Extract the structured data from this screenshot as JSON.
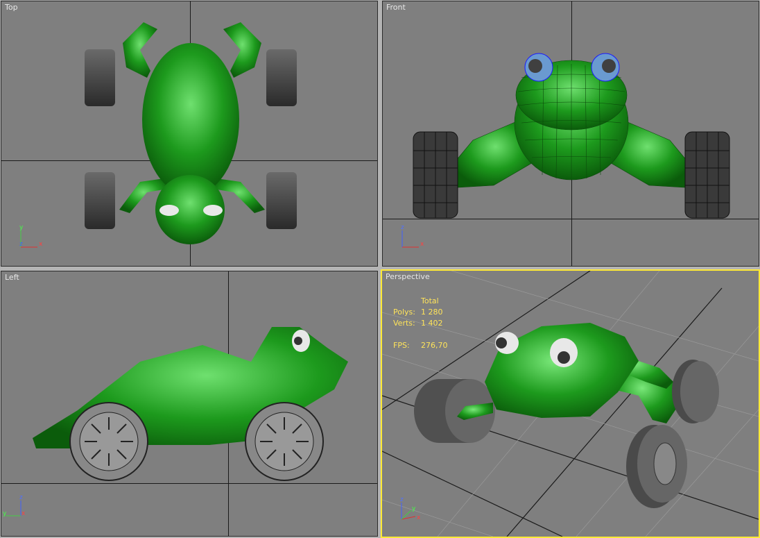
{
  "viewports": {
    "top": {
      "label": "Top",
      "axis_h": "x",
      "axis_v": "y",
      "axis_o": "z"
    },
    "front": {
      "label": "Front",
      "axis_h": "x",
      "axis_v": "z",
      "axis_o": "y"
    },
    "left": {
      "label": "Left",
      "axis_h": "x",
      "axis_v": "z",
      "axis_o": "y"
    },
    "perspective": {
      "label": "Perspective",
      "axis_h": "x",
      "axis_v": "z",
      "axis_o": "y",
      "active": true
    }
  },
  "stats": {
    "header": "Total",
    "polys_label": "Polys:",
    "polys_value": "1 280",
    "verts_label": "Verts:",
    "verts_value": "1 402",
    "fps_label": "FPS:",
    "fps_value": "276,70"
  },
  "colors": {
    "viewport_bg": "#7f7f7f",
    "active_border": "#ffea36",
    "frog_green": "#1f9a1f",
    "wheel_gray": "#3e3e3e",
    "stats_text": "#ffe45a"
  }
}
